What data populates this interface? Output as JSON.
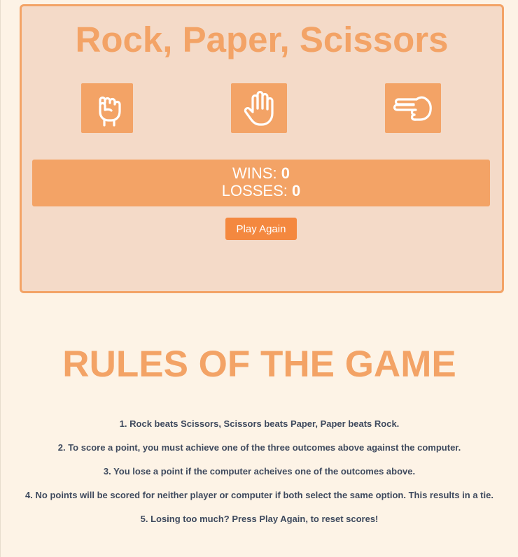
{
  "game": {
    "title": "Rock, Paper, Scissors",
    "choices": [
      {
        "id": "rock",
        "icon": "hand-fist-icon"
      },
      {
        "id": "paper",
        "icon": "hand-open-icon"
      },
      {
        "id": "scissors",
        "icon": "hand-scissors-icon"
      }
    ],
    "score": {
      "wins_label": "WINS: ",
      "wins": "0",
      "losses_label": "LOSSES: ",
      "losses": "0"
    },
    "play_again_label": "Play Again"
  },
  "rules": {
    "title": "RULES OF THE GAME",
    "items": [
      "1. Rock beats Scissors, Scissors beats Paper, Paper beats Rock.",
      "2. To score a point, you must achieve one of the three outcomes above against the computer.",
      "3. You lose a point if the computer acheives one of the outcomes above.",
      "4. No points will be scored for neither player or computer if both select the same option. This results in a tie.",
      "5. Losing too much? Press Play Again, to reset scores!"
    ]
  },
  "colors": {
    "page_background": "#fdf3e6",
    "panel_background": "#f4dac8",
    "accent": "#f3a366",
    "button": "#f4883f",
    "rules_text": "#3f4a5e"
  }
}
